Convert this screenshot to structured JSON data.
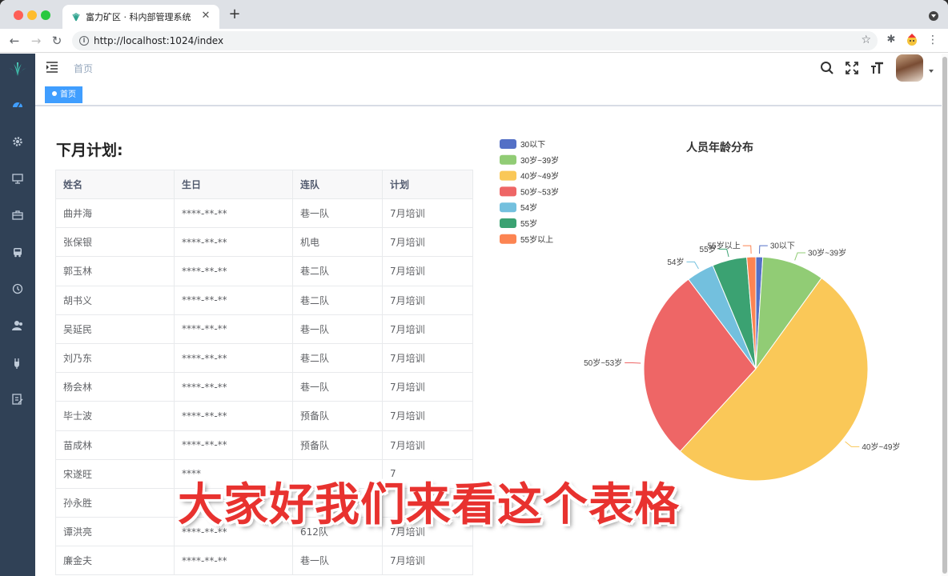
{
  "browser": {
    "tab_title": "富力矿区 · 科内部管理系统",
    "tab_close": "✕",
    "new_tab": "+",
    "url": "http://localhost:1024/index",
    "nav": {
      "back": "←",
      "forward": "→",
      "reload": "↻"
    },
    "menu": "⋮",
    "star": "☆"
  },
  "sidebar": {
    "items": [
      "dashboard-icon",
      "gear-icon",
      "monitor-icon",
      "briefcase-icon",
      "bus-icon",
      "history-icon",
      "user-group-icon",
      "plug-icon",
      "edit-icon"
    ]
  },
  "header": {
    "breadcrumb": "首页",
    "tag_home": "首页"
  },
  "plan": {
    "title": "下月计划:",
    "columns": [
      "姓名",
      "生日",
      "连队",
      "计划"
    ],
    "rows": [
      [
        "曲井海",
        "****-**-**",
        "巷一队",
        "7月培训"
      ],
      [
        "张保银",
        "****-**-**",
        "机电",
        "7月培训"
      ],
      [
        "郭玉林",
        "****-**-**",
        "巷二队",
        "7月培训"
      ],
      [
        "胡书义",
        "****-**-**",
        "巷二队",
        "7月培训"
      ],
      [
        "吴延民",
        "****-**-**",
        "巷一队",
        "7月培训"
      ],
      [
        "刘乃东",
        "****-**-**",
        "巷二队",
        "7月培训"
      ],
      [
        "杨会林",
        "****-**-**",
        "巷一队",
        "7月培训"
      ],
      [
        "毕士波",
        "****-**-**",
        "预备队",
        "7月培训"
      ],
      [
        "苗成林",
        "****-**-**",
        "预备队",
        "7月培训"
      ],
      [
        "宋遂旺",
        "****",
        "",
        "7"
      ],
      [
        "孙永胜",
        "",
        "",
        ""
      ],
      [
        "谭洪亮",
        "****-**-**",
        "612队",
        "7月培训"
      ],
      [
        "廉金夫",
        "****-**-**",
        "巷一队",
        "7月培训"
      ]
    ]
  },
  "chart_data": {
    "type": "pie",
    "title": "人员年龄分布",
    "legend_position": "top-left",
    "slices": [
      {
        "name": "30以下",
        "value": 1,
        "color": "#5470c6"
      },
      {
        "name": "30岁~39岁",
        "value": 9,
        "color": "#91cc75"
      },
      {
        "name": "40岁~49岁",
        "value": 52,
        "color": "#fac858"
      },
      {
        "name": "50岁~53岁",
        "value": 28,
        "color": "#ee6666"
      },
      {
        "name": "54岁",
        "value": 4,
        "color": "#73c0de"
      },
      {
        "name": "55岁",
        "value": 5,
        "color": "#3ba272"
      },
      {
        "name": "55岁以上",
        "value": 1.3,
        "color": "#fc8452"
      }
    ]
  },
  "subtitle": "大家好我们来看这个表格"
}
